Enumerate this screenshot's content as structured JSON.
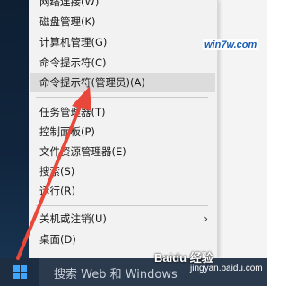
{
  "context_menu": {
    "items": [
      {
        "label": "网络连接(W)"
      },
      {
        "label": "磁盘管理(K)"
      },
      {
        "label": "计算机管理(G)"
      },
      {
        "label": "命令提示符(C)"
      },
      {
        "label": "命令提示符(管理员)(A)",
        "highlighted": true
      },
      {
        "label": "任务管理器(T)"
      },
      {
        "label": "控制面板(P)"
      },
      {
        "label": "文件资源管理器(E)"
      },
      {
        "label": "搜索(S)"
      },
      {
        "label": "运行(R)"
      },
      {
        "label": "关机或注销(U)",
        "has_submenu": true
      },
      {
        "label": "桌面(D)"
      }
    ],
    "submenu_arrow": "›"
  },
  "taskbar": {
    "start_icon": "windows-logo-icon",
    "search_placeholder": "搜索 Web 和 Windows"
  },
  "watermarks": {
    "site": "win7w.com",
    "baidu": "Baidu 经验",
    "url": "jingyan.baidu.com"
  },
  "annotation": {
    "arrow_color": "#e8473a"
  }
}
